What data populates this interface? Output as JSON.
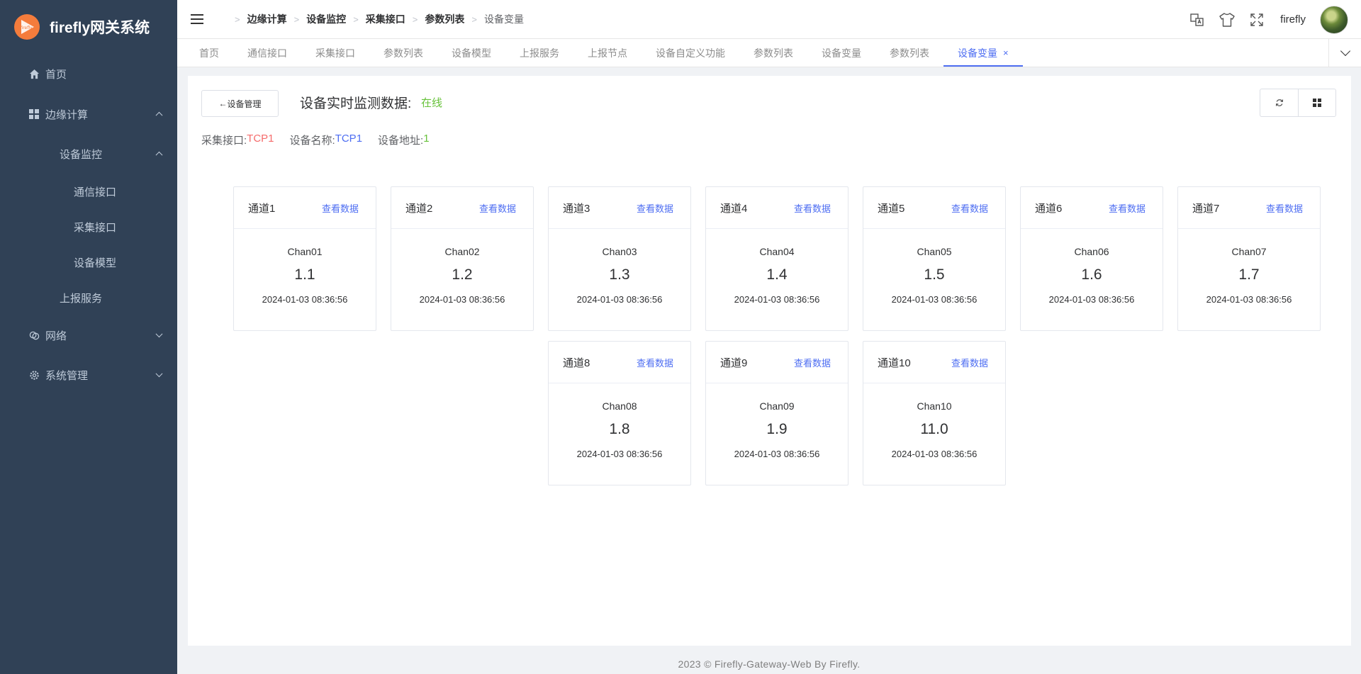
{
  "app": {
    "title": "firefly网关系统",
    "logo_text": "firefly"
  },
  "sidebar": {
    "items": [
      {
        "label": "首页",
        "icon": "home-icon"
      },
      {
        "label": "边缘计算",
        "icon": "grid-icon"
      },
      {
        "label": "设备监控"
      },
      {
        "label": "通信接口"
      },
      {
        "label": "采集接口"
      },
      {
        "label": "设备模型"
      },
      {
        "label": "上报服务"
      },
      {
        "label": "网络",
        "icon": "network-icon"
      },
      {
        "label": "系统管理",
        "icon": "gear-icon"
      }
    ]
  },
  "header": {
    "breadcrumb": [
      "边缘计算",
      "设备监控",
      "采集接口",
      "参数列表",
      "设备变量"
    ],
    "username": "firefly"
  },
  "tabs": [
    {
      "label": "首页"
    },
    {
      "label": "通信接口"
    },
    {
      "label": "采集接口"
    },
    {
      "label": "参数列表"
    },
    {
      "label": "设备模型"
    },
    {
      "label": "上报服务"
    },
    {
      "label": "上报节点"
    },
    {
      "label": "设备自定义功能"
    },
    {
      "label": "参数列表"
    },
    {
      "label": "设备变量"
    },
    {
      "label": "参数列表"
    },
    {
      "label": "设备变量",
      "active": true,
      "close": "×"
    }
  ],
  "main": {
    "back_label": "设备管理",
    "back_arrow": "←",
    "title": "设备实时监测数据:",
    "status": "在线",
    "interface_label": "采集接口:",
    "interface_value": "TCP1",
    "device_name_label": "设备名称:",
    "device_name_value": "TCP1",
    "device_addr_label": "设备地址:",
    "device_addr_value": "1",
    "view_label": "查看数据",
    "channels": [
      {
        "name": "通道1",
        "chan": "Chan01",
        "value": "1.1",
        "time": "2024-01-03 08:36:56"
      },
      {
        "name": "通道2",
        "chan": "Chan02",
        "value": "1.2",
        "time": "2024-01-03 08:36:56"
      },
      {
        "name": "通道3",
        "chan": "Chan03",
        "value": "1.3",
        "time": "2024-01-03 08:36:56"
      },
      {
        "name": "通道4",
        "chan": "Chan04",
        "value": "1.4",
        "time": "2024-01-03 08:36:56"
      },
      {
        "name": "通道5",
        "chan": "Chan05",
        "value": "1.5",
        "time": "2024-01-03 08:36:56"
      },
      {
        "name": "通道6",
        "chan": "Chan06",
        "value": "1.6",
        "time": "2024-01-03 08:36:56"
      },
      {
        "name": "通道7",
        "chan": "Chan07",
        "value": "1.7",
        "time": "2024-01-03 08:36:56"
      },
      {
        "name": "通道8",
        "chan": "Chan08",
        "value": "1.8",
        "time": "2024-01-03 08:36:56"
      },
      {
        "name": "通道9",
        "chan": "Chan09",
        "value": "1.9",
        "time": "2024-01-03 08:36:56"
      },
      {
        "name": "通道10",
        "chan": "Chan10",
        "value": "11.0",
        "time": "2024-01-03 08:36:56"
      }
    ]
  },
  "footer": {
    "text": "2023 © Firefly-Gateway-Web By Firefly."
  },
  "colors": {
    "sidebar_bg": "#304156",
    "accent": "#4e6ef2",
    "online": "#67c23a",
    "interface": "#f56c6c"
  }
}
